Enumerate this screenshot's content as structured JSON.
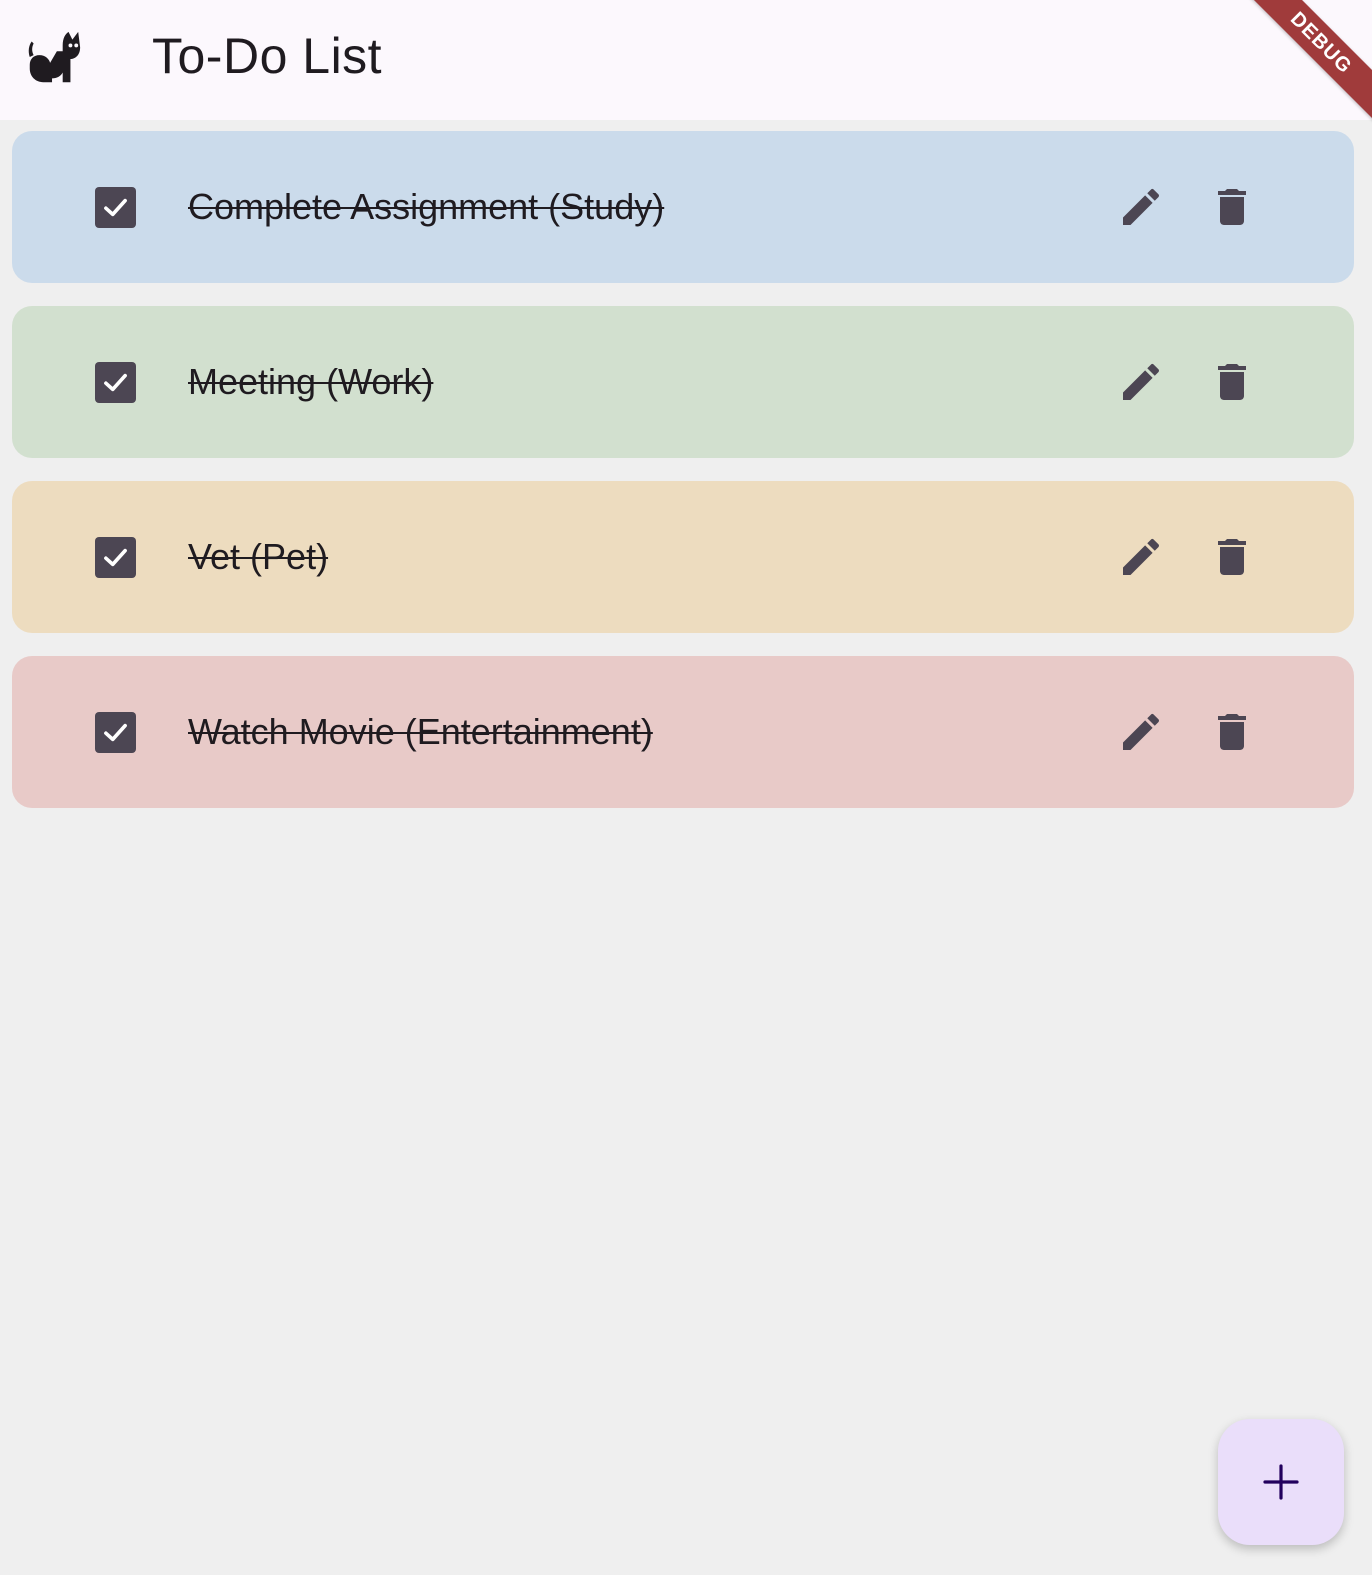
{
  "appbar": {
    "title": "To-Do List",
    "logo_icon": "cat-icon",
    "debug_banner": "DEBUG"
  },
  "tasks": [
    {
      "label": "Complete Assignment (Study)",
      "checked": true,
      "color": "#cbdbeb"
    },
    {
      "label": "Meeting (Work)",
      "checked": true,
      "color": "#d2e0cf"
    },
    {
      "label": "Vet (Pet)",
      "checked": true,
      "color": "#eddcbf"
    },
    {
      "label": "Watch Movie (Entertainment)",
      "checked": true,
      "color": "#e8cac8"
    }
  ],
  "icons": {
    "checkbox": "check-icon",
    "edit": "pencil-icon",
    "delete": "trash-icon",
    "fab": "plus-icon"
  },
  "colors": {
    "background": "#efefef",
    "appbar": "#fcf8fd",
    "icon": "#4c4653",
    "fab": "#eadefa",
    "fab_icon": "#22005d",
    "debug_ribbon": "#a03b3b"
  }
}
